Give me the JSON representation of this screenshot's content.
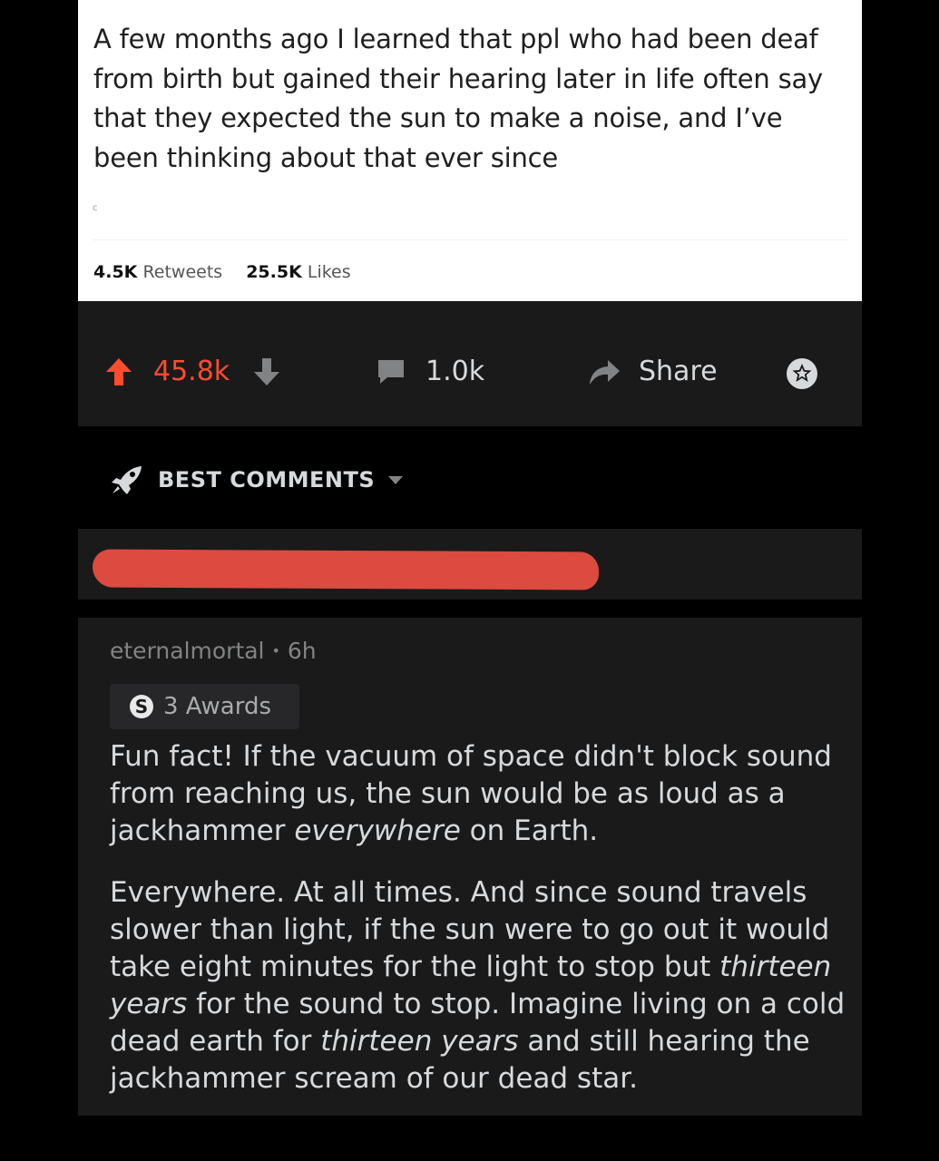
{
  "tweet": {
    "text": "A few months ago I learned that ppl who had been deaf from birth but gained their hearing later in life often say that they expected the sun to make a noise, and I’ve been thinking about that ever since",
    "date_mark": "c",
    "retweets_count": "4.5K",
    "retweets_label": "Retweets",
    "likes_count": "25.5K",
    "likes_label": "Likes"
  },
  "post": {
    "score": "45.8k",
    "comments": "1.0k",
    "share_label": "Share",
    "colors": {
      "upvote": "#ff4c2e",
      "panel": "#1a1a1b",
      "redaction": "#dc4a40"
    }
  },
  "sort": {
    "label": "BEST COMMENTS"
  },
  "comment": {
    "author": "eternalmortal",
    "separator": "•",
    "age": "6h",
    "awards": "3 Awards",
    "p1_a": "Fun fact! If the vacuum of space didn't block sound from reaching us, the sun would be as loud as a jackhammer ",
    "p1_em": "everywhere",
    "p1_b": " on Earth.",
    "p2_a": "Everywhere. At all times. And since sound travels slower than light, if the sun were to go out it would take eight minutes for the light to stop but ",
    "p2_em1": "thirteen years",
    "p2_b": " for the sound to stop. Imagine living on a cold dead earth for ",
    "p2_em2": "thirteen years",
    "p2_c": " and still hearing the jackhammer scream of our dead star."
  }
}
